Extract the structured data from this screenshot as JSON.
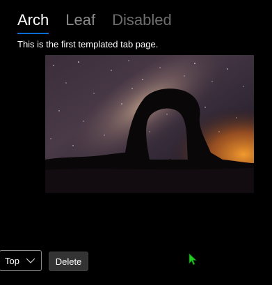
{
  "tabs": [
    {
      "label": "Arch",
      "state": "selected"
    },
    {
      "label": "Leaf",
      "state": "normal"
    },
    {
      "label": "Disabled",
      "state": "disabled"
    }
  ],
  "tab_content": {
    "text": "This is the first templated tab page.",
    "image_icon": "night-sky-arch-photo"
  },
  "controls": {
    "placement_select": {
      "value": "Top",
      "icon": "chevron-down-icon"
    },
    "delete_label": "Delete"
  },
  "pointer": {
    "icon": "mouse-pointer-icon",
    "color": "#22cc22"
  },
  "colors": {
    "background": "#000000",
    "accent": "#0a6ed1",
    "text": "#ffffff",
    "muted": "#8a8a8a"
  }
}
